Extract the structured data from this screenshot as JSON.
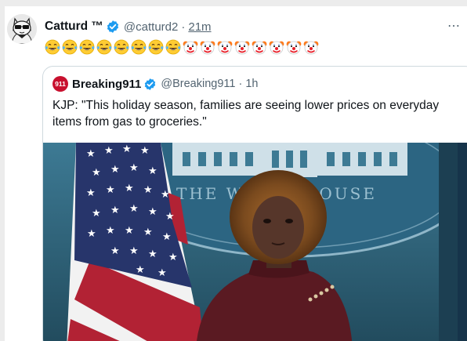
{
  "tweet": {
    "author_name": "Catturd ™",
    "handle": "@catturd2",
    "separator": "·",
    "time": "21m",
    "more_icon": "ellipsis-icon",
    "emojis": [
      "laugh-cry",
      "laugh-cry",
      "laugh-cry",
      "laugh-cry",
      "laugh-cry",
      "laugh-cry",
      "laugh-cry",
      "laugh-cry",
      "clown",
      "clown",
      "clown",
      "clown",
      "clown",
      "clown",
      "clown",
      "clown"
    ]
  },
  "quoted": {
    "logo_text": "911",
    "author_name": "Breaking911",
    "handle": "@Breaking911",
    "separator": "·",
    "time": "1h",
    "text": "KJP: \"This holiday season, families are seeing lower prices on everyday items from gas to groceries.\"",
    "media": {
      "seal_text": "THE WHITE HOUSE",
      "colors": {
        "backdrop": "#2e5f76",
        "flag_red": "#b22234",
        "flag_blue": "#3c3b6e",
        "jacket": "#5a1a22"
      }
    }
  },
  "colors": {
    "verified": "#1d9bf0",
    "muted": "#536471",
    "text": "#0f1419"
  }
}
